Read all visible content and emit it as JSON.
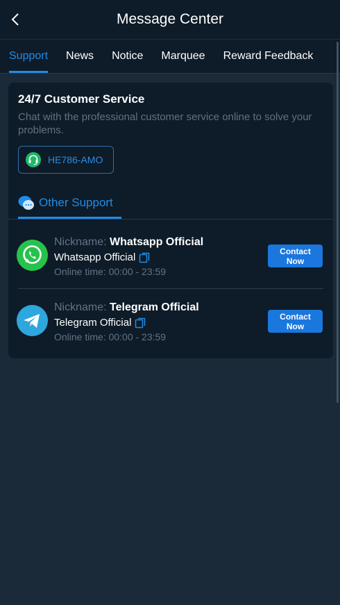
{
  "header": {
    "title": "Message Center"
  },
  "tabs": [
    {
      "label": "Support",
      "active": true
    },
    {
      "label": "News"
    },
    {
      "label": "Notice"
    },
    {
      "label": "Marquee"
    },
    {
      "label": "Reward Feedback"
    }
  ],
  "customer_service": {
    "title": "24/7 Customer Service",
    "description": "Chat with the professional customer service online to solve your problems.",
    "code": "HE786-AMO"
  },
  "other_support": {
    "label": "Other Support"
  },
  "contacts": [
    {
      "nickname_label": "Nickname:",
      "nickname": "Whatsapp Official",
      "account": "Whatsapp Official",
      "online_time": "Online time: 00:00 - 23:59",
      "button": "Contact Now",
      "icon": "whatsapp-icon"
    },
    {
      "nickname_label": "Nickname:",
      "nickname": "Telegram Official",
      "account": "Telegram Official",
      "online_time": "Online time: 00:00 - 23:59",
      "button": "Contact Now",
      "icon": "telegram-icon"
    }
  ],
  "colors": {
    "accent": "#1f8de8",
    "background": "#1b2a38",
    "panel": "#0e1b28",
    "button": "#1a77dd"
  }
}
